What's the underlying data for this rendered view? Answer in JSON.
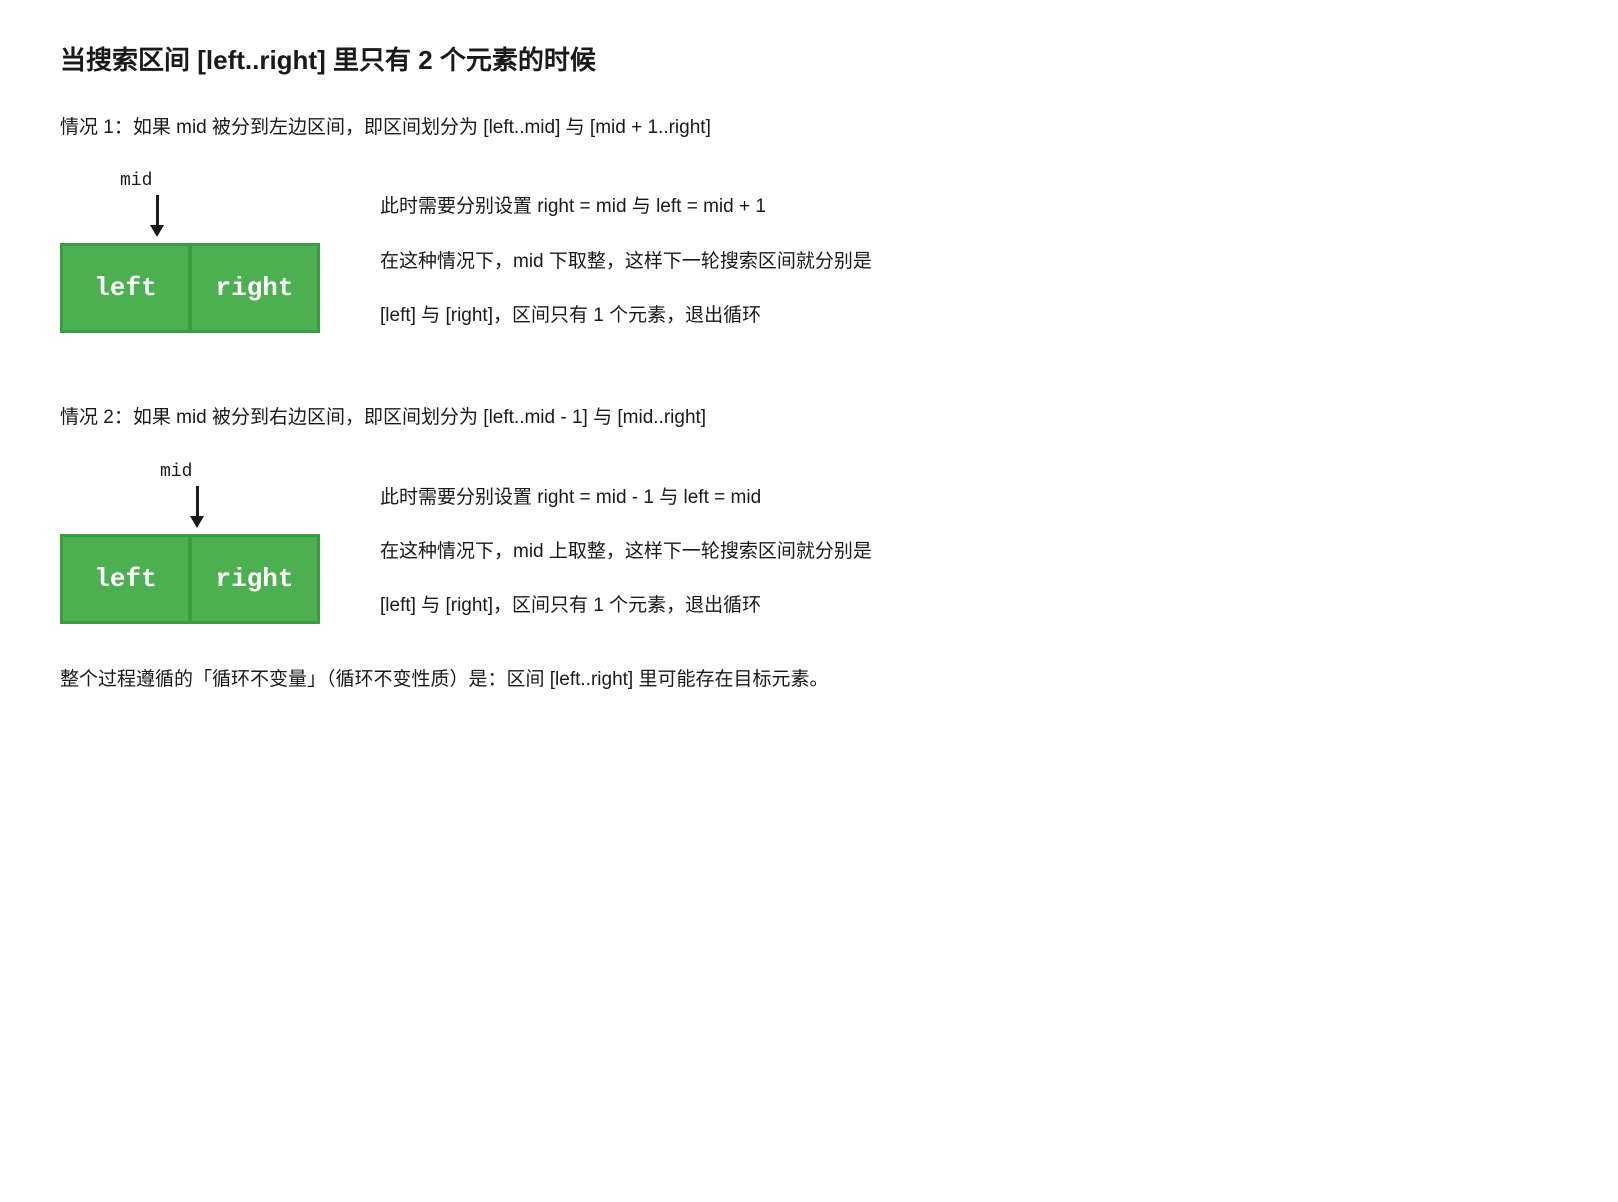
{
  "page": {
    "title": "当搜索区间 [left..right] 里只有 2 个元素的时候",
    "case1": {
      "header": "情况 1：如果 mid 被分到左边区间，即区间划分为 [left..mid] 与 [mid + 1..right]",
      "mid_label": "mid",
      "cell_left": "left",
      "cell_right": "right",
      "desc1": "此时需要分别设置 right = mid 与 left = mid + 1",
      "desc2": "在这种情况下，mid 下取整，这样下一轮搜索区间就分别是",
      "desc3": "[left] 与 [right]，区间只有 1 个元素，退出循环"
    },
    "case2": {
      "header": "情况 2：如果 mid 被分到右边区间，即区间划分为 [left..mid - 1] 与 [mid..right]",
      "mid_label": "mid",
      "cell_left": "left",
      "cell_right": "right",
      "desc1": "此时需要分别设置 right = mid - 1 与 left = mid",
      "desc2": "在这种情况下，mid 上取整，这样下一轮搜索区间就分别是",
      "desc3": "[left] 与 [right]，区间只有 1 个元素，退出循环"
    },
    "footer": "整个过程遵循的「循环不变量」（循环不变性质）是：区间 [left..right] 里可能存在目标元素。"
  }
}
